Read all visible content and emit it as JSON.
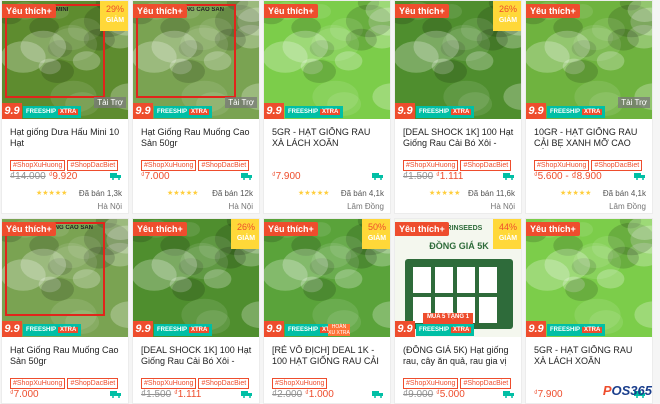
{
  "common": {
    "favorite": "Yêu thích+",
    "freeship": "FREESHIP",
    "xtra": "XTRA",
    "badge99": "9.9",
    "sponsored": "Tài Trợ",
    "stars": "★★★★★",
    "currency": "₫",
    "hoan_xu": "HOÀN XU XTRA"
  },
  "products": [
    {
      "title": "Hạt giống Dưa Hấu Mini 10 Hạt",
      "tags": [
        "#ShopXuHuong",
        "#ShopDacBiet"
      ],
      "old_price": "14.000",
      "price": "9.920",
      "sold": "Đã bán 1,3k",
      "location": "Hà Nội",
      "discount": "29%",
      "discount_label": "GIẢM",
      "banner": "DƯA HẤU MINI",
      "sponsored": true,
      "framed": true,
      "green": "#5e8c2f"
    },
    {
      "title": "Hạt Giống Rau Muống Cao Sản 50gr",
      "tags": [
        "#ShopXuHuong",
        "#ShopDacBiet"
      ],
      "old_price": "",
      "price": "7.000",
      "sold": "Đã bán 12k",
      "location": "Hà Nội",
      "discount": "",
      "banner": "RAU MUỐNG CAO SẢN",
      "sponsored": true,
      "framed": true,
      "green": "#7aa352"
    },
    {
      "title": "5GR - HẠT GIỐNG RAU XÀ LÁCH XOĂN",
      "tags": [],
      "old_price": "",
      "price": "7.900",
      "sold": "Đã bán 4,1k",
      "location": "Lâm Đồng",
      "discount": "",
      "banner": "",
      "sponsored": false,
      "framed": false,
      "green": "#7ccd4a"
    },
    {
      "title": "[DEAL SHOCK 1K] 100 Hạt Giống Rau Cải Bó Xôi - Rau...",
      "tags": [
        "#ShopXuHuong",
        "#ShopDacBiet"
      ],
      "old_price": "1.500",
      "price": "1.111",
      "sold": "Đã bán 11,6k",
      "location": "Hà Nội",
      "discount": "26%",
      "discount_label": "GIẢM",
      "banner": "",
      "sponsored": false,
      "framed": false,
      "green": "#4f8e2e"
    },
    {
      "title": "10GR - HẠT GIỐNG RAU CẢI BẸ XANH MỠ CAO SẢN",
      "tags": [
        "#ShopXuHuong",
        "#ShopDacBiet"
      ],
      "old_price": "",
      "price": "5.600 - ₫8.900",
      "sold": "Đã bán 4,1k",
      "location": "Lâm Đồng",
      "discount": "",
      "banner": "",
      "sponsored": true,
      "framed": false,
      "green": "#6fb33f"
    },
    {
      "title": "Hạt Giống Rau Muống Cao Sản 50gr",
      "tags": [
        "#ShopXuHuong",
        "#ShopDacBiet"
      ],
      "old_price": "",
      "price": "7.000",
      "sold": "",
      "location": "",
      "discount": "",
      "banner": "RAU MUỐNG CAO SẢN",
      "sponsored": false,
      "framed": true,
      "green": "#7aa352"
    },
    {
      "title": "[DEAL SHOCK 1K] 100 Hạt Giống Rau Cải Bó Xôi - Rau...",
      "tags": [
        "#ShopXuHuong",
        "#ShopDacBiet"
      ],
      "old_price": "1.500",
      "price": "1.111",
      "sold": "",
      "location": "",
      "discount": "26%",
      "discount_label": "GIẢM",
      "banner": "",
      "sponsored": false,
      "framed": false,
      "green": "#4f8e2e"
    },
    {
      "title": "[RẺ VÔ ĐỊCH] DEAL 1K - 100 HẠT GIỐNG RAU CẢI CAN...",
      "tags": [
        "#ShopXuHuong"
      ],
      "old_price": "2.000",
      "price": "1.000",
      "sold": "",
      "location": "",
      "discount": "50%",
      "discount_label": "GIẢM",
      "banner": "",
      "sponsored": false,
      "framed": false,
      "green": "#5aa33a",
      "hoan": true
    },
    {
      "title": "(ĐỒNG GIÁ 5K) Hạt giống rau, cây ăn quả, rau gia vị",
      "tags": [
        "#ShopXuHuong",
        "#ShopDacBiet"
      ],
      "old_price": "9.000",
      "price": "5.000",
      "sold": "",
      "location": "",
      "discount": "44%",
      "discount_label": "GIẢM",
      "banner": "",
      "sponsored": false,
      "framed": false,
      "green": "#ffffff",
      "seeds": true,
      "seeds_brand": "MARINSEEDS",
      "seeds_price": "ĐỒNG GIÁ 5K",
      "seeds_deal": "MUA 5 TẶNG 1"
    },
    {
      "title": "5GR - HẠT GIỐNG RAU XÀ LÁCH XOĂN",
      "tags": [],
      "old_price": "",
      "price": "7.900",
      "sold": "",
      "location": "",
      "discount": "",
      "banner": "",
      "sponsored": false,
      "framed": false,
      "green": "#7ccd4a"
    }
  ],
  "watermark": {
    "prefix": "P",
    "text": "OS365"
  }
}
